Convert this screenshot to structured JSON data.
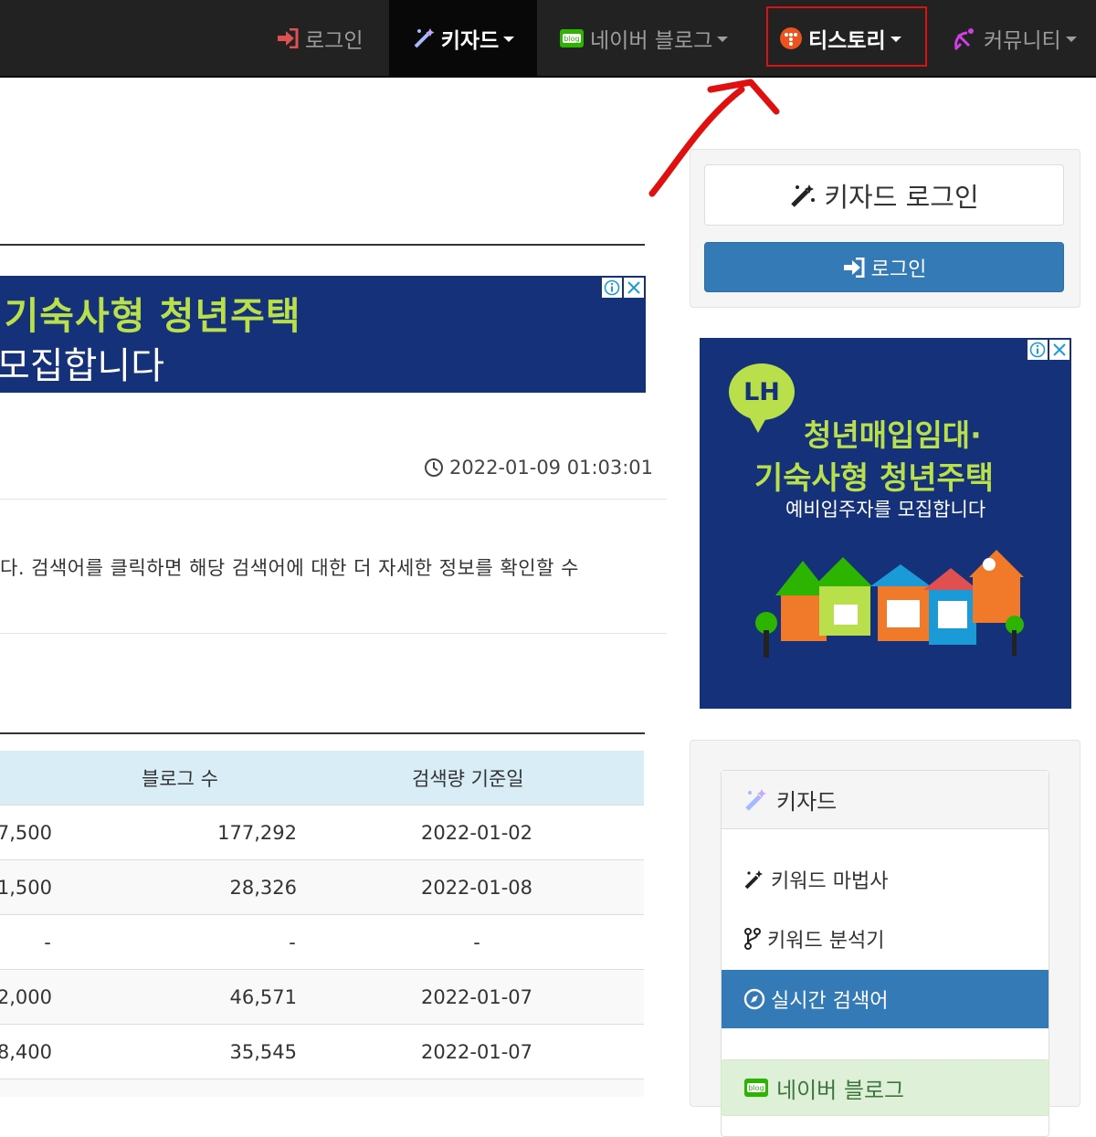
{
  "nav": {
    "login": "로그인",
    "keyzard": "키자드",
    "naver_blog": "네이버 블로그",
    "tistory": "티스토리",
    "community": "커뮤니티"
  },
  "ad_top": {
    "line1": "·기숙사형 청년주택",
    "line2": "모집합니다"
  },
  "timestamp": "2022-01-09 01:03:01",
  "description": "다. 검색어를 클릭하면 해당 검색어에 대한 더 자세한 정보를 확인할 수",
  "table": {
    "headers": [
      "블로그 수",
      "검색량 기준일"
    ],
    "rows": [
      [
        "7,500",
        "177,292",
        "2022-01-02"
      ],
      [
        "1,500",
        "28,326",
        "2022-01-08"
      ],
      [
        "-",
        "-",
        "-"
      ],
      [
        "2,000",
        "46,571",
        "2022-01-07"
      ],
      [
        "8,400",
        "35,545",
        "2022-01-07"
      ]
    ]
  },
  "sidebar": {
    "login_title": "키자드 로그인",
    "login_button": "로그인",
    "ad": {
      "badge": "LH",
      "line1": "청년매입임대·",
      "line2": "기숙사형 청년주택",
      "line3": "예비입주자를 모집합니다"
    },
    "keyzard_panel": {
      "title": "키자드",
      "items": [
        "키워드 마법사",
        "키워드 분석기",
        "실시간 검색어"
      ]
    },
    "naver_panel": "네이버 블로그"
  },
  "colors": {
    "navbar": "#222222",
    "primary": "#337ab7",
    "table_head": "#d9edf7",
    "ad_blue": "#14317a",
    "ad_green": "#b9e04a",
    "annotation_red": "#e01010"
  }
}
